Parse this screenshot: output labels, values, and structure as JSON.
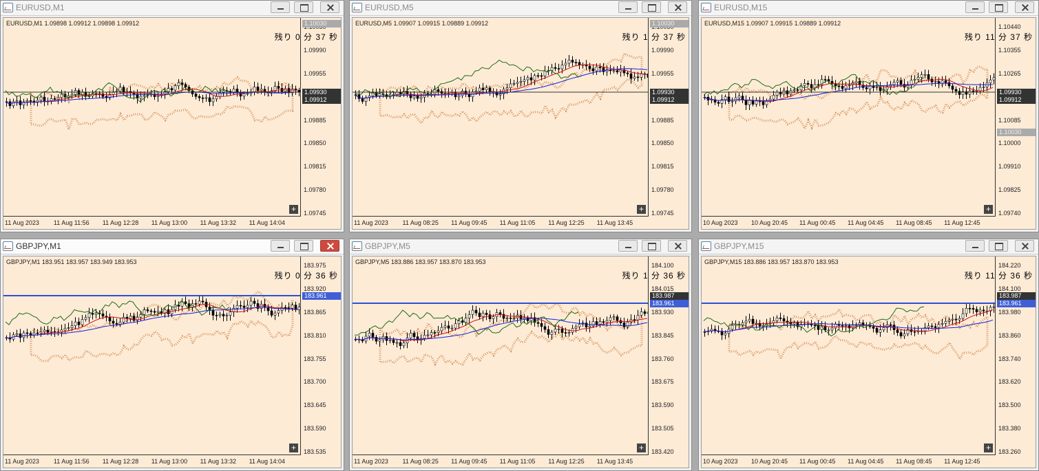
{
  "charts": [
    {
      "title": "EURUSD,M1",
      "info": "EURUSD,M1  1.09898 1.09912 1.09898 1.09912",
      "timer": "残り 0 分 37 秒",
      "y_ticks": [
        "1.10030",
        "1.09990",
        "1.09955",
        "1.09920",
        "1.09885",
        "1.09850",
        "1.09815",
        "1.09780",
        "1.09745"
      ],
      "x_ticks": [
        "11 Aug 2023",
        "11 Aug 11:56",
        "11 Aug 12:28",
        "11 Aug 13:00",
        "11 Aug 13:32",
        "11 Aug 14:04"
      ],
      "price_tags": [
        "1.09930",
        "1.09912"
      ],
      "top_tag": "1.10030",
      "active": false
    },
    {
      "title": "EURUSD,M5",
      "info": "EURUSD,M5  1.09907 1.09915 1.09889 1.09912",
      "timer": "残り 1 分 37 秒",
      "y_ticks": [
        "1.10030",
        "1.09990",
        "1.09955",
        "1.09920",
        "1.09885",
        "1.09850",
        "1.09815",
        "1.09780",
        "1.09745"
      ],
      "x_ticks": [
        "11 Aug 2023",
        "11 Aug 08:25",
        "11 Aug 09:45",
        "11 Aug 11:05",
        "11 Aug 12:25",
        "11 Aug 13:45"
      ],
      "price_tags": [
        "1.09930",
        "1.09912"
      ],
      "top_tag": "1.10030",
      "active": false
    },
    {
      "title": "EURUSD,M15",
      "info": "EURUSD,M15  1.09907 1.09915 1.09889 1.09912",
      "timer": "残り 11 分 37 秒",
      "y_ticks": [
        "1.10440",
        "1.10355",
        "1.10265",
        "1.10175",
        "1.10085",
        "1.10000",
        "1.09910",
        "1.09825",
        "1.09740"
      ],
      "x_ticks": [
        "10 Aug 2023",
        "10 Aug 20:45",
        "11 Aug 00:45",
        "11 Aug 04:45",
        "11 Aug 08:45",
        "11 Aug 12:45"
      ],
      "price_tags": [
        "1.09930",
        "1.09912"
      ],
      "top_tag": "1.10030",
      "active": false
    },
    {
      "title": "GBPJPY,M1",
      "info": "GBPJPY,M1  183.951 183.957 183.949 183.953",
      "timer": "残り 0 分 36 秒",
      "y_ticks": [
        "183.975",
        "183.920",
        "183.865",
        "183.810",
        "183.755",
        "183.700",
        "183.645",
        "183.590",
        "183.535"
      ],
      "x_ticks": [
        "11 Aug 2023",
        "11 Aug 11:56",
        "11 Aug 12:28",
        "11 Aug 13:00",
        "11 Aug 13:32",
        "11 Aug 14:04"
      ],
      "price_tags": [
        "183.961"
      ],
      "active": true
    },
    {
      "title": "GBPJPY,M5",
      "info": "GBPJPY,M5  183.886 183.957 183.870 183.953",
      "timer": "残り 1 分 36 秒",
      "y_ticks": [
        "184.100",
        "184.015",
        "183.930",
        "183.845",
        "183.760",
        "183.675",
        "183.590",
        "183.505",
        "183.420"
      ],
      "x_ticks": [
        "11 Aug 2023",
        "11 Aug 08:25",
        "11 Aug 09:45",
        "11 Aug 11:05",
        "11 Aug 12:25",
        "11 Aug 13:45"
      ],
      "price_tags": [
        "183.987",
        "183.961"
      ],
      "active": false
    },
    {
      "title": "GBPJPY,M15",
      "info": "GBPJPY,M15  183.886 183.957 183.870 183.953",
      "timer": "残り 11 分 36 秒",
      "y_ticks": [
        "184.220",
        "184.100",
        "183.980",
        "183.860",
        "183.740",
        "183.620",
        "183.500",
        "183.380",
        "183.260"
      ],
      "x_ticks": [
        "10 Aug 2023",
        "10 Aug 20:45",
        "11 Aug 00:45",
        "11 Aug 04:45",
        "11 Aug 08:45",
        "11 Aug 12:45"
      ],
      "price_tags": [
        "183.987",
        "183.961"
      ],
      "active": false
    }
  ],
  "colors": {
    "chart_bg": "#fdebd6",
    "tenkan": "#d01010",
    "kijun": "#1020e0",
    "chikou": "#1f6b14",
    "cloud": "#c9742c",
    "candle_up": "#ffffff",
    "candle_down": "#000000"
  }
}
